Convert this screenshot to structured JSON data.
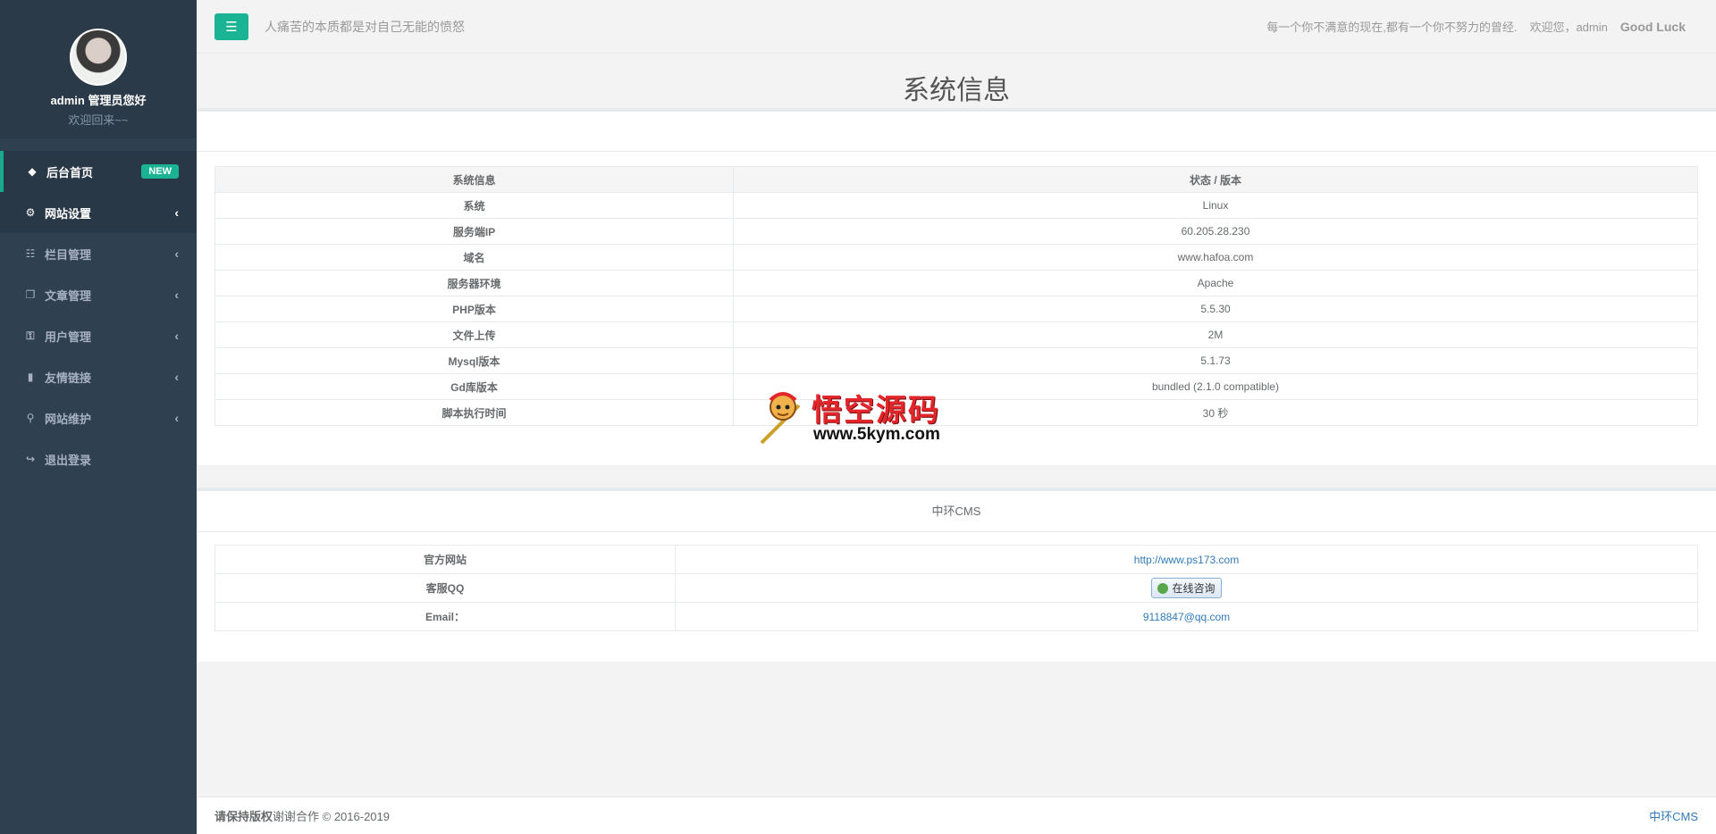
{
  "sidebar": {
    "profile": {
      "name": "admin  管理员您好",
      "welcome": "欢迎回来~~"
    },
    "items": [
      {
        "label": "后台首页",
        "icon": "diamond-icon",
        "badge": "NEW"
      },
      {
        "label": "网站设置",
        "icon": "gear-icon"
      },
      {
        "label": "栏目管理",
        "icon": "sitemap-icon"
      },
      {
        "label": "文章管理",
        "icon": "copy-icon"
      },
      {
        "label": "用户管理",
        "icon": "key-icon"
      },
      {
        "label": "友情链接",
        "icon": "bookmark-icon"
      },
      {
        "label": "网站维护",
        "icon": "wrench-icon"
      },
      {
        "label": "退出登录",
        "icon": "sign-out-icon"
      }
    ]
  },
  "header": {
    "motto": "人痛苦的本质都是对自己无能的愤怒",
    "hint": "每一个你不满意的现在,都有一个你不努力的曾经.",
    "welcome": "欢迎您，admin",
    "luck": "Good Luck"
  },
  "page": {
    "title": "系统信息"
  },
  "sysinfo": {
    "headers": [
      "系统信息",
      "状态 / 版本"
    ],
    "rows": [
      {
        "key": "系统",
        "value": "Linux"
      },
      {
        "key": "服务端IP",
        "value": "60.205.28.230"
      },
      {
        "key": "域名",
        "value": "www.hafoa.com"
      },
      {
        "key": "服务器环境",
        "value": "Apache"
      },
      {
        "key": "PHP版本",
        "value": "5.5.30"
      },
      {
        "key": "文件上传",
        "value": "2M"
      },
      {
        "key": "Mysql版本",
        "value": "5.1.73"
      },
      {
        "key": "Gd库版本",
        "value": "bundled (2.1.0 compatible)"
      },
      {
        "key": "脚本执行时间",
        "value": "30 秒"
      }
    ]
  },
  "cms": {
    "title": "中环CMS",
    "site_label": "官方网站",
    "site_url": "http://www.ps173.com",
    "qq_label": "客服QQ",
    "qq_button": "在线咨询",
    "email_label": "Email：",
    "email": "9118847@qq.com"
  },
  "footer": {
    "bold": "请保持版权",
    "text": "谢谢合作 © 2016-2019",
    "right": "中环CMS"
  },
  "watermark": {
    "title": "悟空源码",
    "url": "www.5kym.com"
  },
  "colors": {
    "accent": "#1ab394",
    "sidebar": "#2f4050",
    "link": "#337ab7"
  }
}
